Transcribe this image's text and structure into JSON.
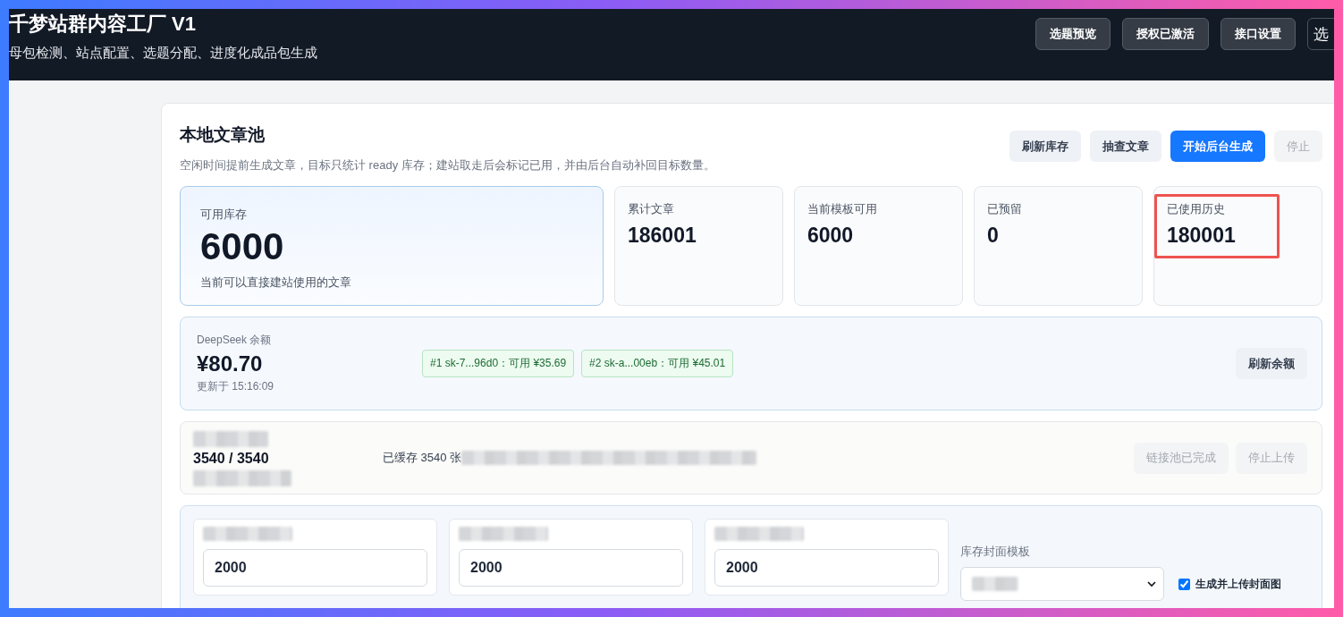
{
  "header": {
    "title": "千梦站群内容工厂 V1",
    "subtitle": "母包检测、站点配置、选题分配、进度化成品包生成",
    "buttons": [
      {
        "label": "选题预览",
        "kind": "filled"
      },
      {
        "label": "授权已激活",
        "kind": "filled"
      },
      {
        "label": "接口设置",
        "kind": "filled"
      },
      {
        "label": "选",
        "kind": "outline"
      }
    ]
  },
  "pool": {
    "title": "本地文章池",
    "description": "空闲时间提前生成文章，目标只统计 ready 库存；建站取走后会标记已用，并由后台自动补回目标数量。",
    "actions": [
      {
        "label": "刷新库存",
        "kind": "secondary",
        "disabled": false
      },
      {
        "label": "抽查文章",
        "kind": "secondary",
        "disabled": false
      },
      {
        "label": "开始后台生成",
        "kind": "primary",
        "disabled": false
      },
      {
        "label": "停止",
        "kind": "secondary",
        "disabled": true
      }
    ],
    "stats": [
      {
        "label": "可用库存",
        "value": "6000",
        "note": "当前可以直接建站使用的文章",
        "kind": "main",
        "highlighted": false
      },
      {
        "label": "累计文章",
        "value": "186001",
        "kind": "small",
        "highlighted": false
      },
      {
        "label": "当前模板可用",
        "value": "6000",
        "kind": "small",
        "highlighted": false
      },
      {
        "label": "已预留",
        "value": "0",
        "kind": "small",
        "highlighted": false
      },
      {
        "label": "已使用历史",
        "value": "180001",
        "kind": "small",
        "highlighted": true
      }
    ]
  },
  "balance": {
    "label": "DeepSeek 余额",
    "amount": "¥80.70",
    "updated": "更新于 15:16:09",
    "keys": [
      "#1 sk-7...96d0：可用 ¥35.69",
      "#2 sk-a...00eb：可用 ¥45.01"
    ],
    "button": "刷新余额"
  },
  "upload": {
    "count": "3540 / 3540",
    "status": "已缓存 3540 张",
    "buttons": [
      {
        "label": "链接池已完成",
        "disabled": true
      },
      {
        "label": "停止上传",
        "disabled": true
      }
    ]
  },
  "config": {
    "fields": [
      {
        "value": "2000"
      },
      {
        "value": "2000"
      },
      {
        "value": "2000"
      }
    ],
    "template_label": "库存封面模板",
    "checkbox": {
      "label": "生成并上传封面图",
      "checked": true
    }
  }
}
